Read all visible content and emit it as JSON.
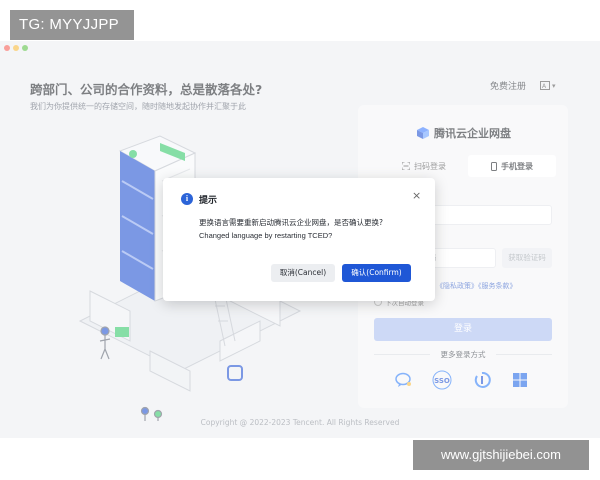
{
  "overlay_tag": {
    "text": "TG: MYYJJPP"
  },
  "watermark": {
    "text": "www.gjtshijiebei.com"
  },
  "hero": {
    "title": "跨部门、公司的合作资料，总是散落各处?",
    "subtitle": "我们为你提供统一的存储空间，随时随地发起协作并汇聚于此"
  },
  "top_right": {
    "register_label": "免费注册",
    "language_label": "▾"
  },
  "login_panel": {
    "logo_text": "腾讯云企业网盘",
    "tabs": [
      {
        "label": "扫码登录",
        "icon": "qr-scan-icon",
        "active": false
      },
      {
        "label": "手机登录",
        "icon": "phone-icon",
        "active": true
      }
    ],
    "phone_placeholder": "请输入手机号",
    "code_placeholder": "码",
    "get_code_label": "获取验证码",
    "policy_text": "《隐私政策》《服务条款》",
    "auto_login_label": "下次自动登录",
    "login_button": "登录",
    "more_methods_label": "更多登录方式",
    "alt_methods": [
      {
        "name": "wechat-work-icon"
      },
      {
        "name": "sso-icon",
        "label": "SSO"
      },
      {
        "name": "tencent-meeting-icon"
      },
      {
        "name": "windows-icon"
      }
    ]
  },
  "footer": {
    "copyright": "Copyright @ 2022-2023 Tencent. All Rights Reserved"
  },
  "dialog": {
    "title": "提示",
    "message_cn": "更换语言需要重新启动腾讯云企业网盘，是否确认更换?",
    "message_en": "Changed language by restarting TCED?",
    "cancel_label": "取消(Cancel)",
    "confirm_label": "确认(Confirm)",
    "close_glyph": "×"
  },
  "colors": {
    "accent": "#1f57d6",
    "login_disabled": "#a9bdf0",
    "illustration_blue": "#1d4fd1",
    "illustration_green": "#2fc766"
  }
}
